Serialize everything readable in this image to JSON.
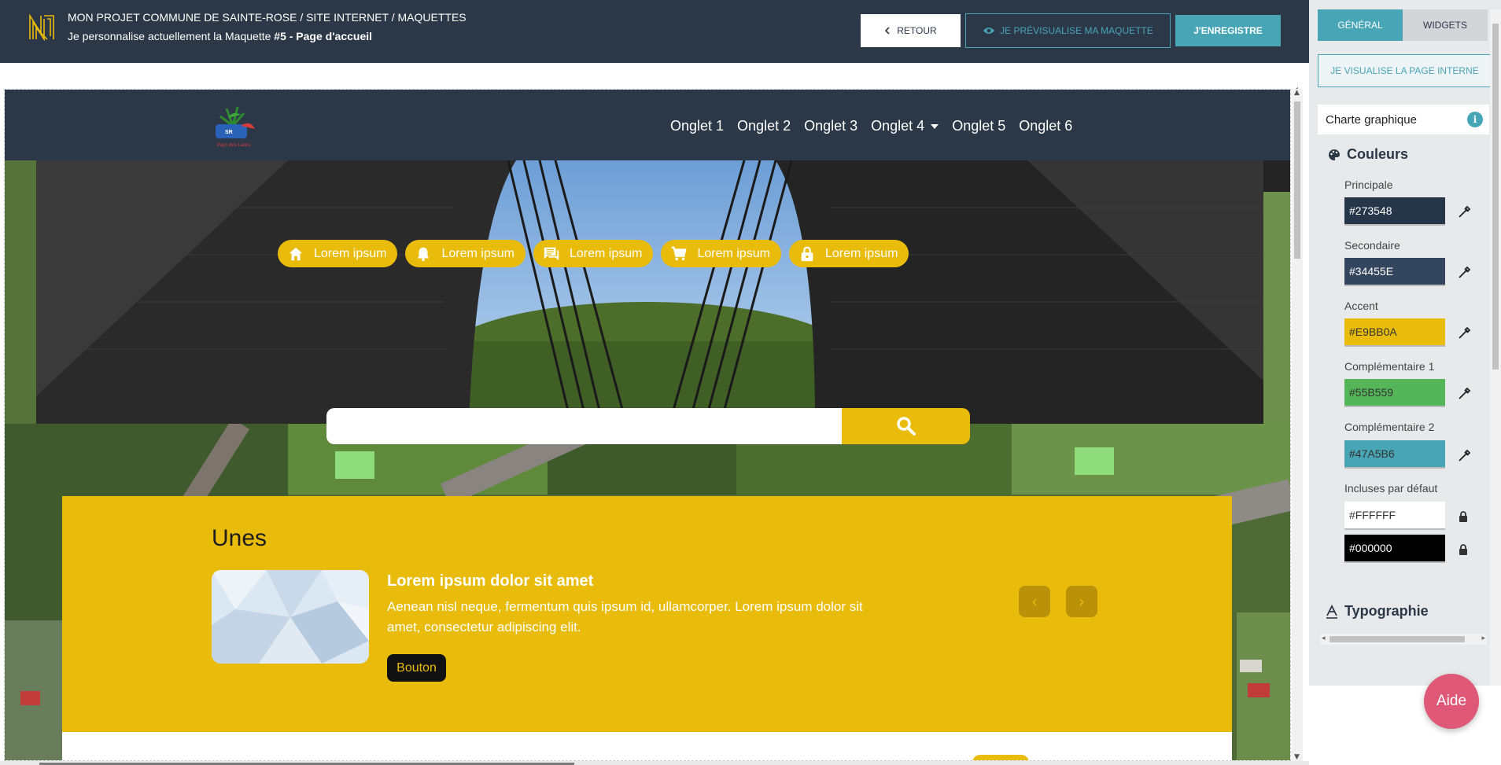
{
  "header": {
    "project_title": "MON PROJET COMMUNE DE SAINTE-ROSE / SITE INTERNET / MAQUETTES",
    "subtitle_prefix": "Je personnalise actuellement la Maquette ",
    "subtitle_bold": "#5 - Page d'accueil",
    "back_label": "RETOUR",
    "preview_label": "JE PRÉVISUALISE MA MAQUETTE",
    "save_label": "J'ENREGISTRE"
  },
  "site": {
    "nav_tabs": [
      "Onglet 1",
      "Onglet 2",
      "Onglet 3",
      "Onglet 4",
      "Onglet 5",
      "Onglet 6"
    ],
    "logo_tagline": "Pays des Laves",
    "quick_links": [
      {
        "icon": "home-icon",
        "label": "Lorem ipsum"
      },
      {
        "icon": "bell-icon",
        "label": "Lorem ipsum"
      },
      {
        "icon": "chat-icon",
        "label": "Lorem ipsum"
      },
      {
        "icon": "cart-icon",
        "label": "Lorem ipsum"
      },
      {
        "icon": "lock-icon",
        "label": "Lorem ipsum"
      }
    ],
    "unes": {
      "title": "Unes",
      "headline": "Lorem ipsum dolor sit amet",
      "text": "Aenean nisl neque, fermentum quis ipsum id, ullamcorper. Lorem ipsum dolor sit amet, consectetur adipiscing elit.",
      "button_label": "Bouton",
      "prev": "‹",
      "next": "›"
    }
  },
  "panel": {
    "tab_general": "GÉNÉRAL",
    "tab_widgets": "WIDGETS",
    "visualise_label": "JE VISUALISE LA PAGE INTERNE",
    "section_select": "Charte graphique",
    "info": "i",
    "couleurs_heading": "Couleurs",
    "colors": [
      {
        "label": "Principale",
        "value": "#273548",
        "swatch": "#273548"
      },
      {
        "label": "Secondaire",
        "value": "#34455E",
        "swatch": "#34455E"
      },
      {
        "label": "Accent",
        "value": "#E9BB0A",
        "swatch": "#E9BB0A"
      },
      {
        "label": "Complémentaire 1",
        "value": "#55B559",
        "swatch": "#55B559"
      },
      {
        "label": "Complémentaire 2",
        "value": "#47A5B6",
        "swatch": "#47A5B6"
      }
    ],
    "default_label": "Incluses par défaut",
    "default_colors": [
      {
        "value": "#FFFFFF",
        "swatch": "#FFFFFF"
      },
      {
        "value": "#000000",
        "swatch": "#000000"
      }
    ],
    "typo_heading": "Typographie",
    "help_label": "Aide"
  },
  "theme": {
    "header_bg": "#2c3848",
    "accent": "#e9bb0a",
    "teal": "#47a5b6",
    "help_pink": "#e05877"
  }
}
